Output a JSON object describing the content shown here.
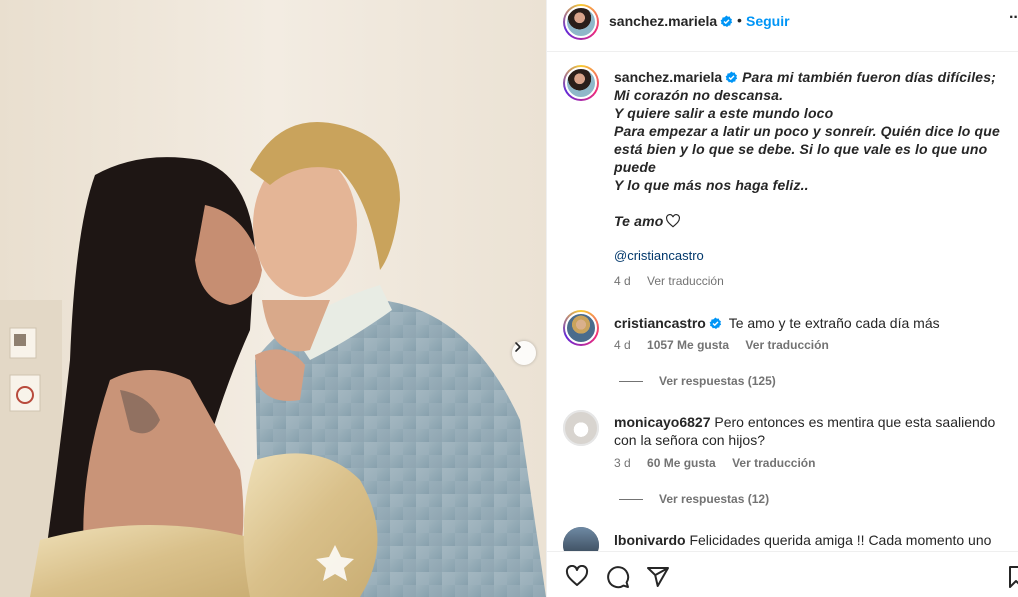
{
  "post": {
    "username": "sanchez.mariela",
    "dot": "•",
    "follow_label": "Seguir",
    "more": "···"
  },
  "caption": {
    "username": "sanchez.mariela",
    "text": "Para mi también fueron días difíciles;\nMi corazón no descansa.\nY quiere salir a este mundo loco\nPara empezar a latir un poco y sonreír. Quién dice lo que está bien y lo que se debe. Si lo que vale es lo que uno puede\nY lo que más nos haga feliz..\n\nTe amo",
    "mention": "@cristiancastro",
    "time": "4 d",
    "translate": "Ver traducción"
  },
  "comments": [
    {
      "username": "cristiancastro",
      "verified": true,
      "text": "Te amo y te extraño cada día más",
      "time": "4 d",
      "likes": "1057 Me gusta",
      "translate": "Ver traducción",
      "replies": "Ver respuestas (125)"
    },
    {
      "username": "monicayo6827",
      "verified": false,
      "text": "Pero entonces es mentira que esta saaliendo con la señora con hijos?",
      "time": "3 d",
      "likes": "60 Me gusta",
      "translate": "Ver traducción",
      "replies": "Ver respuestas (12)"
    },
    {
      "username": "lbonivardo",
      "verified": false,
      "text": "Felicidades querida amiga !! Cada momento uno"
    }
  ],
  "icons": {
    "verified": "verified-badge-icon",
    "like": "heart-icon",
    "comment": "comment-icon",
    "share": "share-icon",
    "save": "bookmark-icon",
    "next": "chevron-right-icon"
  },
  "colors": {
    "accent": "#0095f6",
    "verified": "#0095f6",
    "mention": "#00376b",
    "muted": "#737373"
  }
}
